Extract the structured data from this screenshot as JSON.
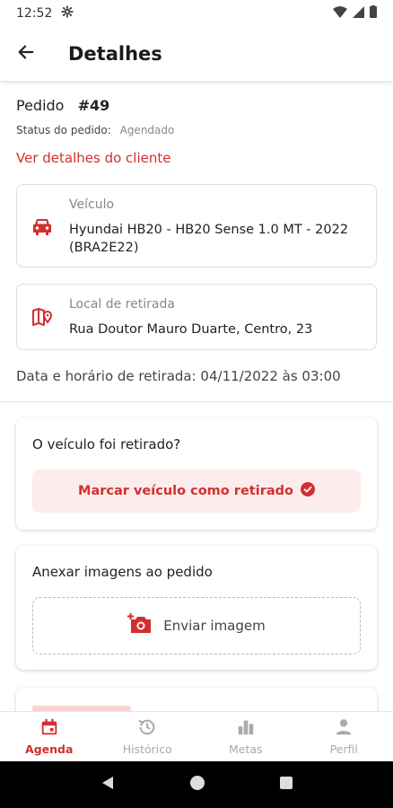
{
  "status_bar": {
    "time": "12:52"
  },
  "app_bar": {
    "title": "Detalhes"
  },
  "order": {
    "label": "Pedido",
    "number": "#49",
    "status_label": "Status do pedido:",
    "status_value": "Agendado",
    "client_link": "Ver detalhes do cliente"
  },
  "vehicle": {
    "label": "Veículo",
    "value": "Hyundai HB20 - HB20 Sense 1.0 MT - 2022 (BRA2E22)"
  },
  "pickup": {
    "label": "Local de retirada",
    "value": "Rua Doutor Mauro Duarte, Centro, 23"
  },
  "pickup_datetime": "Data e horário de retirada: 04/11/2022 às 03:00",
  "withdrawn_section": {
    "question": "O veículo foi retirado?",
    "button_label": "Marcar veículo como retirado"
  },
  "images_section": {
    "title": "Anexar imagens ao pedido",
    "upload_label": "Enviar imagem"
  },
  "bottom_nav": {
    "items": [
      {
        "label": "Agenda",
        "icon": "calendar-icon",
        "active": true
      },
      {
        "label": "Histórico",
        "icon": "history-icon",
        "active": false
      },
      {
        "label": "Metas",
        "icon": "bar-chart-icon",
        "active": false
      },
      {
        "label": "Perfil",
        "icon": "person-icon",
        "active": false
      }
    ]
  },
  "colors": {
    "accent": "#d32f2f",
    "accent_light": "#fdecec"
  }
}
